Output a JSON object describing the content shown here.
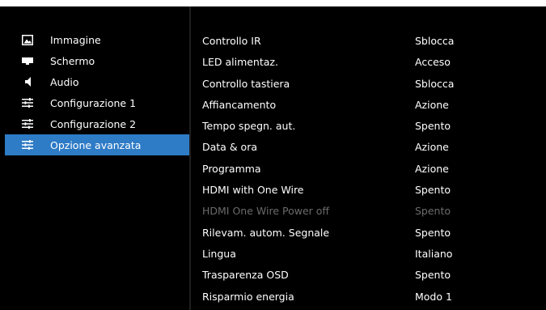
{
  "sidebar": {
    "items": [
      {
        "label": "Immagine",
        "icon": "image-icon",
        "active": false
      },
      {
        "label": "Schermo",
        "icon": "screen-icon",
        "active": false
      },
      {
        "label": "Audio",
        "icon": "speaker-icon",
        "active": false
      },
      {
        "label": "Configurazione 1",
        "icon": "sliders-icon",
        "active": false
      },
      {
        "label": "Configurazione 2",
        "icon": "sliders-icon",
        "active": false
      },
      {
        "label": "Opzione avanzata",
        "icon": "sliders-icon",
        "active": true
      }
    ]
  },
  "settings": {
    "rows": [
      {
        "label": "Controllo IR",
        "value": "Sblocca",
        "enabled": true
      },
      {
        "label": "LED alimentaz.",
        "value": "Acceso",
        "enabled": true
      },
      {
        "label": "Controllo tastiera",
        "value": "Sblocca",
        "enabled": true
      },
      {
        "label": "Affiancamento",
        "value": "Azione",
        "enabled": true
      },
      {
        "label": "Tempo spegn. aut.",
        "value": "Spento",
        "enabled": true
      },
      {
        "label": "Data & ora",
        "value": "Azione",
        "enabled": true
      },
      {
        "label": "Programma",
        "value": "Azione",
        "enabled": true
      },
      {
        "label": "HDMI with One Wire",
        "value": "Spento",
        "enabled": true
      },
      {
        "label": "HDMI One Wire Power off",
        "value": "Spento",
        "enabled": false
      },
      {
        "label": "Rilevam. autom. Segnale",
        "value": "Spento",
        "enabled": true
      },
      {
        "label": "Lingua",
        "value": "Italiano",
        "enabled": true
      },
      {
        "label": "Trasparenza OSD",
        "value": "Spento",
        "enabled": true
      },
      {
        "label": "Risparmio energia",
        "value": "Modo 1",
        "enabled": true
      }
    ]
  },
  "colors": {
    "background": "#000000",
    "highlight": "#2e7bc6",
    "text": "#ffffff",
    "disabled_text": "#6b6b6b"
  }
}
